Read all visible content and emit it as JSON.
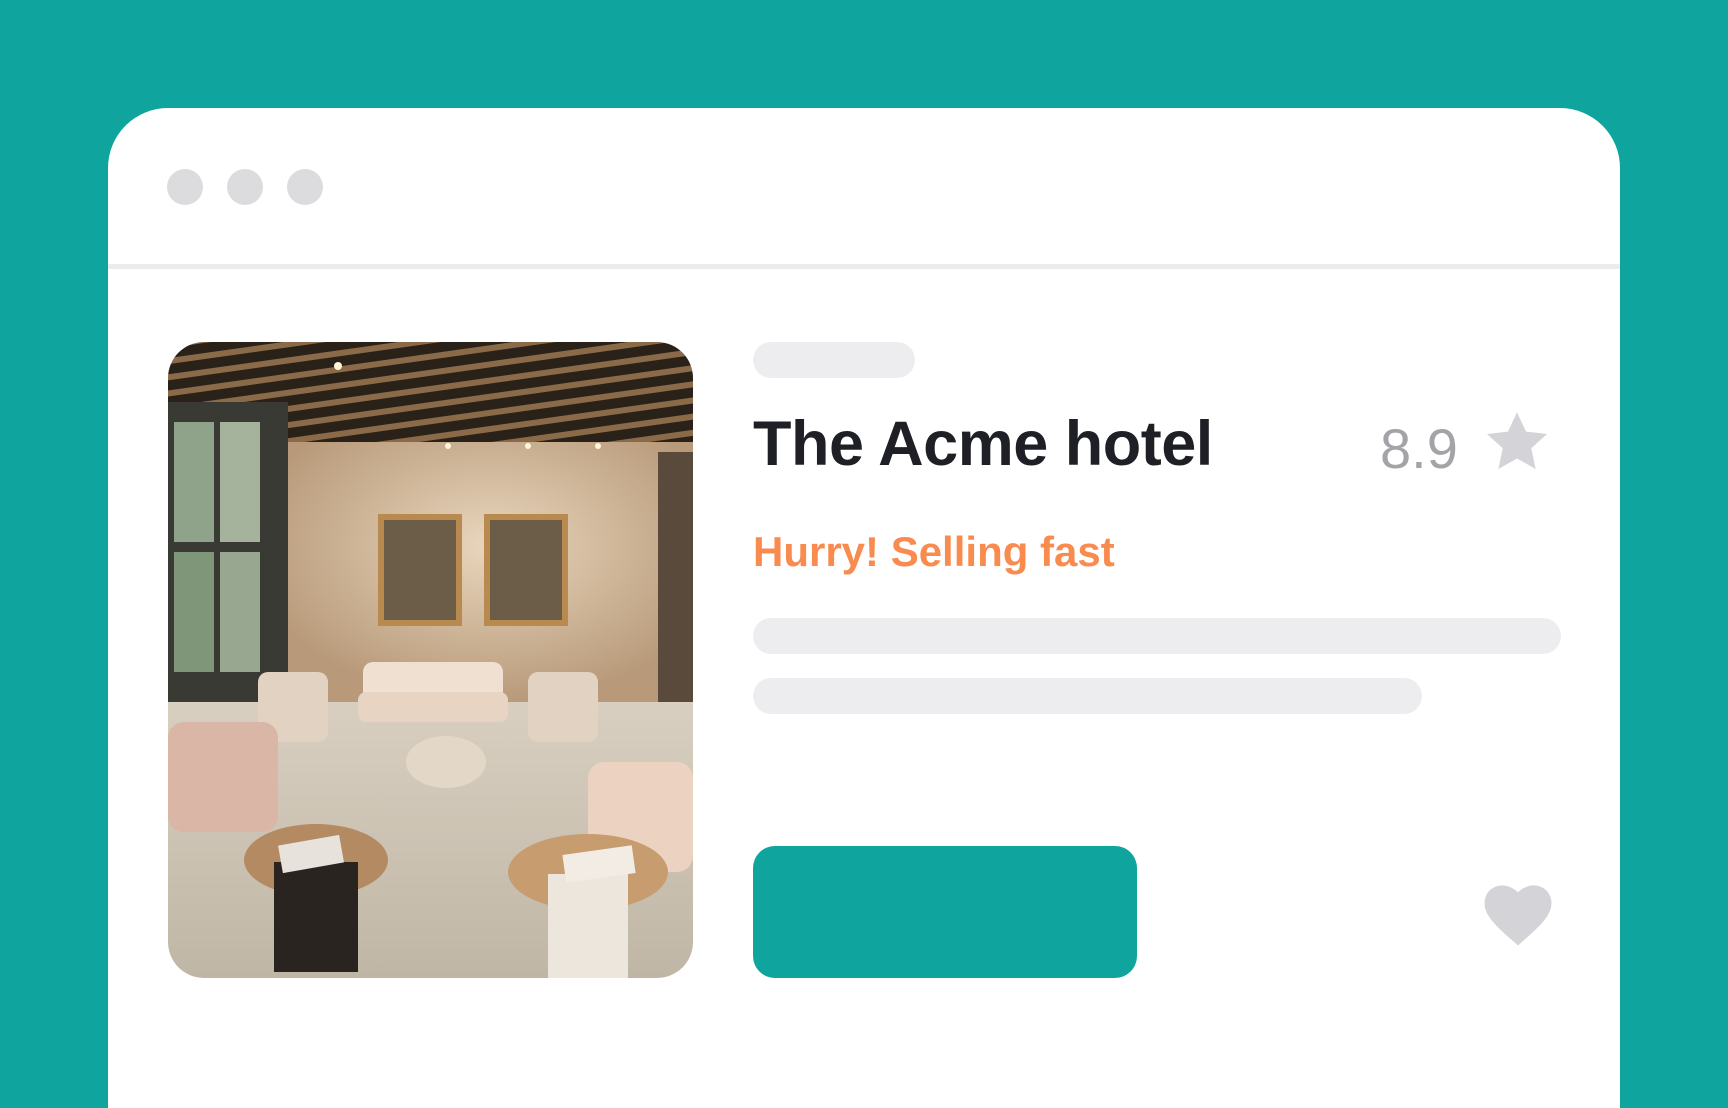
{
  "window": {
    "controls": [
      "window-dot",
      "window-dot",
      "window-dot"
    ]
  },
  "hotel": {
    "name": "The Acme hotel",
    "rating": "8.9",
    "urgency": "Hurry! Selling fast"
  },
  "icons": {
    "rating": "star-icon",
    "favorite": "heart-icon"
  },
  "colors": {
    "background": "#0fa59e",
    "accent": "#0fa59e",
    "urgency": "#f98b4e",
    "title": "#1f1f26",
    "muted": "#a3a3a8",
    "placeholder": "#ededf0"
  }
}
